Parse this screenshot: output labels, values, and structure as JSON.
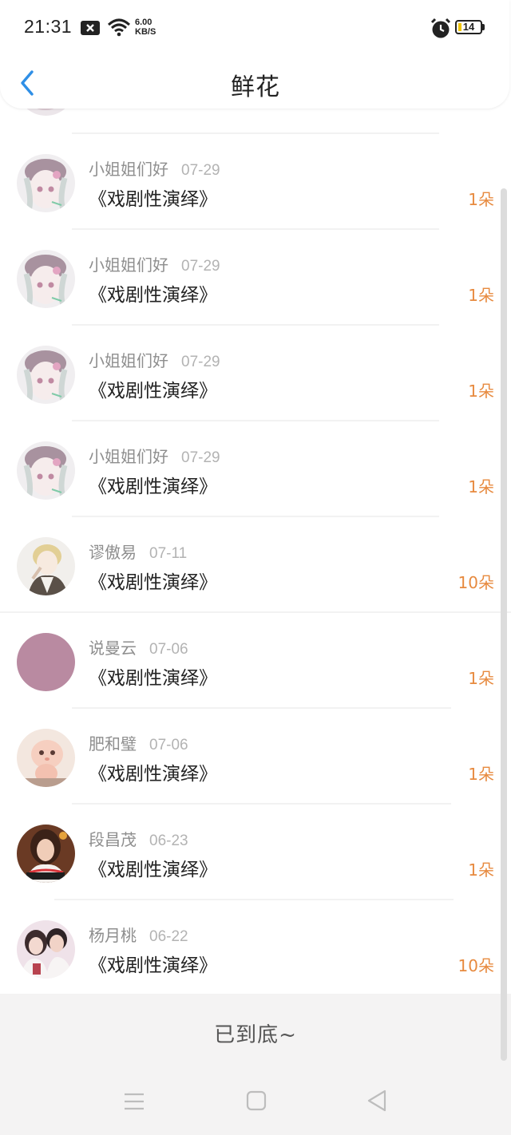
{
  "status_bar": {
    "time": "21:31",
    "net_speed_value": "6.00",
    "net_speed_unit": "KB/S",
    "battery": "14",
    "icons": [
      "notification-x-icon",
      "wifi-icon",
      "alarm-icon",
      "battery-icon"
    ]
  },
  "header": {
    "title": "鲜花",
    "back_icon": "chevron-left-icon",
    "accent_color": "#2f8fe6"
  },
  "gifts": [
    {
      "user": "小姐姐们好",
      "date": "07-29",
      "work": "《戏剧性演绎》",
      "count": "1朵",
      "avatar": "anime-girl"
    },
    {
      "user": "小姐姐们好",
      "date": "07-29",
      "work": "《戏剧性演绎》",
      "count": "1朵",
      "avatar": "anime-girl"
    },
    {
      "user": "小姐姐们好",
      "date": "07-29",
      "work": "《戏剧性演绎》",
      "count": "1朵",
      "avatar": "anime-girl"
    },
    {
      "user": "小姐姐们好",
      "date": "07-29",
      "work": "《戏剧性演绎》",
      "count": "1朵",
      "avatar": "anime-girl"
    },
    {
      "user": "谬傲易",
      "date": "07-11",
      "work": "《戏剧性演绎》",
      "count": "10朵",
      "avatar": "blond-boy"
    },
    {
      "user": "说曼云",
      "date": "07-06",
      "work": "《戏剧性演绎》",
      "count": "1朵",
      "avatar": "solid-mauve"
    },
    {
      "user": "肥和璧",
      "date": "07-06",
      "work": "《戏剧性演绎》",
      "count": "1朵",
      "avatar": "doll"
    },
    {
      "user": "段昌茂",
      "date": "06-23",
      "work": "《戏剧性演绎》",
      "count": "1朵",
      "avatar": "photo-girl"
    },
    {
      "user": "杨月桃",
      "date": "06-22",
      "work": "《戏剧性演绎》",
      "count": "10朵",
      "avatar": "couple"
    }
  ],
  "footer": {
    "end_text": "已到底~"
  },
  "colors": {
    "count": "#e78a3f",
    "mauve_avatar": "#b98aa1"
  },
  "nav_bar": {
    "icons": [
      "menu-icon",
      "home-square-icon",
      "back-triangle-icon"
    ]
  }
}
